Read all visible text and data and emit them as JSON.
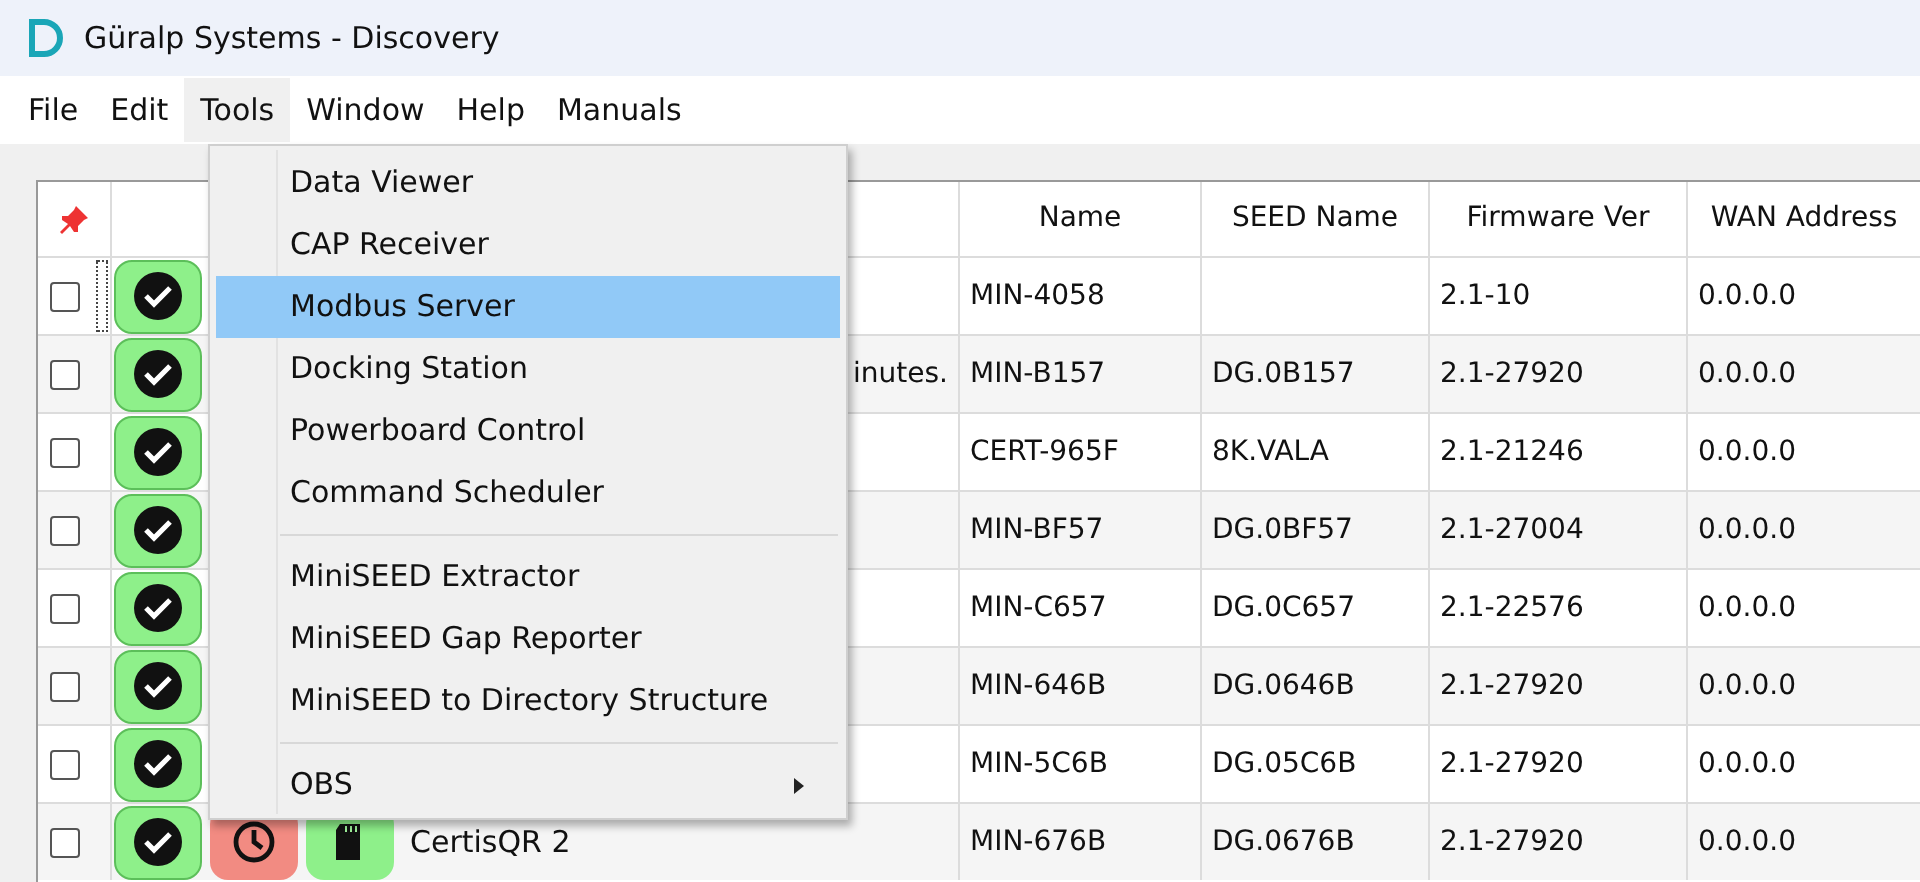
{
  "window": {
    "title": "Güralp Systems - Discovery"
  },
  "menu_bar": [
    {
      "label": "File",
      "selected": false
    },
    {
      "label": "Edit",
      "selected": false
    },
    {
      "label": "Tools",
      "selected": true
    },
    {
      "label": "Window",
      "selected": false
    },
    {
      "label": "Help",
      "selected": false
    },
    {
      "label": "Manuals",
      "selected": false
    }
  ],
  "tools_menu": [
    {
      "kind": "item",
      "label": "Data Viewer",
      "selected": false,
      "submenu": false
    },
    {
      "kind": "item",
      "label": "CAP Receiver",
      "selected": false,
      "submenu": false
    },
    {
      "kind": "item",
      "label": "Modbus Server",
      "selected": true,
      "submenu": false
    },
    {
      "kind": "item",
      "label": "Docking Station",
      "selected": false,
      "submenu": false
    },
    {
      "kind": "item",
      "label": "Powerboard Control",
      "selected": false,
      "submenu": false
    },
    {
      "kind": "item",
      "label": "Command Scheduler",
      "selected": false,
      "submenu": false
    },
    {
      "kind": "separator"
    },
    {
      "kind": "item",
      "label": "MiniSEED Extractor",
      "selected": false,
      "submenu": false
    },
    {
      "kind": "item",
      "label": "MiniSEED Gap Reporter",
      "selected": false,
      "submenu": false
    },
    {
      "kind": "item",
      "label": "MiniSEED to Directory Structure",
      "selected": false,
      "submenu": false
    },
    {
      "kind": "separator"
    },
    {
      "kind": "item",
      "label": "OBS",
      "selected": false,
      "submenu": true
    }
  ],
  "table": {
    "columns": [
      "Name",
      "SEED Name",
      "Firmware Ver",
      "WAN Address"
    ],
    "rows": [
      {
        "checked": false,
        "focused": true,
        "status_ok": true,
        "name": "MIN-4058",
        "firmware": "2.1-10",
        "wan": "0.0.0.0"
      },
      {
        "checked": false,
        "focused": false,
        "status_ok": true,
        "tail": "inutes.",
        "name": "MIN-B157",
        "seed": "DG.0B157",
        "firmware": "2.1-27920",
        "wan": "0.0.0.0"
      },
      {
        "checked": false,
        "focused": false,
        "status_ok": true,
        "name": "CERT-965F",
        "seed": "8K.VALA",
        "firmware": "2.1-21246",
        "wan": "0.0.0.0"
      },
      {
        "checked": false,
        "focused": false,
        "status_ok": true,
        "name": "MIN-BF57",
        "seed": "DG.0BF57",
        "firmware": "2.1-27004",
        "wan": "0.0.0.0"
      },
      {
        "checked": false,
        "focused": false,
        "status_ok": true,
        "name": "MIN-C657",
        "seed": "DG.0C657",
        "firmware": "2.1-22576",
        "wan": "0.0.0.0"
      },
      {
        "checked": false,
        "focused": false,
        "status_ok": true,
        "name": "MIN-646B",
        "seed": "DG.0646B",
        "firmware": "2.1-27920",
        "wan": "0.0.0.0"
      },
      {
        "checked": false,
        "focused": false,
        "status_ok": true,
        "name": "MIN-5C6B",
        "seed": "DG.05C6B",
        "firmware": "2.1-27920",
        "wan": "0.0.0.0"
      },
      {
        "checked": false,
        "focused": false,
        "status_ok": true,
        "icons": [
          {
            "kind": "clock"
          },
          {
            "kind": "sd-card"
          }
        ],
        "label": "CertisQR 2",
        "name": "MIN-676B",
        "seed": "DG.0676B",
        "firmware": "2.1-27920",
        "wan": "0.0.0.0"
      }
    ]
  }
}
